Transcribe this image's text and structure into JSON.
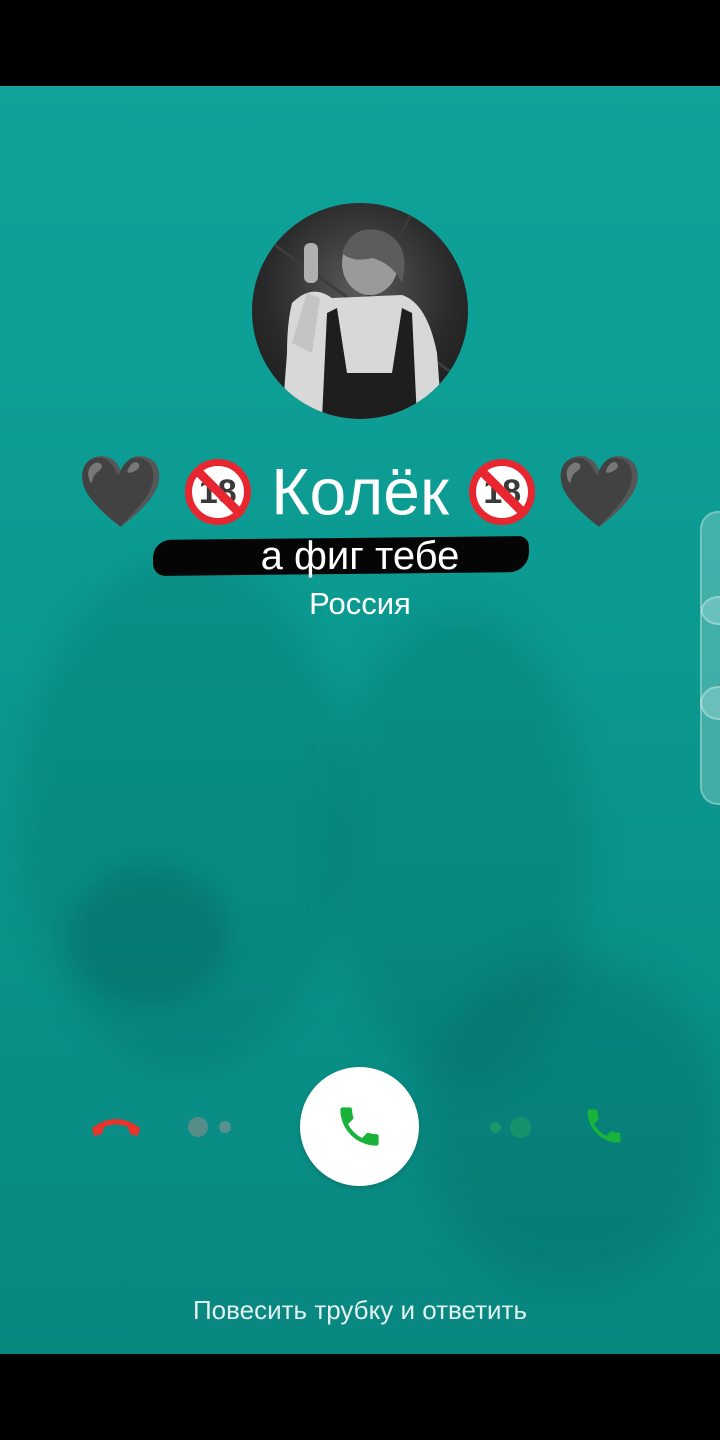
{
  "caller": {
    "heart_left": "🖤",
    "heart_right": "🖤",
    "badge": "18",
    "name": "Колёк",
    "status": "а фиг тебе",
    "location": "Россия"
  },
  "controls": {
    "decline_icon": "phone-hangup-icon",
    "answer_icon": "phone-icon",
    "accept_icon": "phone-icon"
  },
  "hint": "Повесить трубку и ответить",
  "colors": {
    "background": "#0b9990",
    "decline": "#e8342a",
    "accept": "#19b33b",
    "forbidden": "#e8262f"
  }
}
